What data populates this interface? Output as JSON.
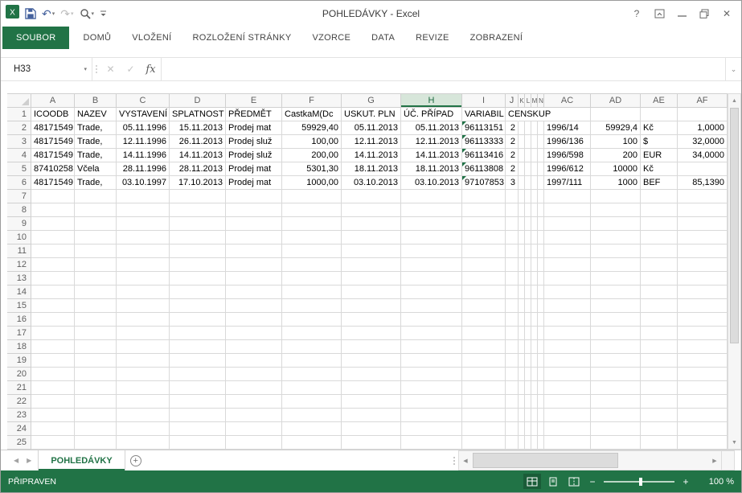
{
  "window": {
    "title": "POHLEDÁVKY - Excel",
    "help_label": "?",
    "close_label": "✕"
  },
  "qat": {
    "icons": [
      "excel-logo",
      "save",
      "undo",
      "redo",
      "print-preview",
      "customize-qat"
    ]
  },
  "ribbon": {
    "tabs": [
      "SOUBOR",
      "DOMŮ",
      "VLOŽENÍ",
      "ROZLOŽENÍ STRÁNKY",
      "VZORCE",
      "DATA",
      "REVIZE",
      "ZOBRAZENÍ"
    ]
  },
  "formula_bar": {
    "name_box": "H33",
    "cancel_label": "✕",
    "enter_label": "✓",
    "fx_label": "fx",
    "formula_value": ""
  },
  "grid": {
    "selected_column": "H",
    "total_rows": 25,
    "columns": [
      {
        "letter": "A",
        "width": 54,
        "align": "right"
      },
      {
        "letter": "B",
        "width": 52,
        "align": "left"
      },
      {
        "letter": "C",
        "width": 66,
        "align": "right"
      },
      {
        "letter": "D",
        "width": 70,
        "align": "right"
      },
      {
        "letter": "E",
        "width": 70,
        "align": "left"
      },
      {
        "letter": "F",
        "width": 74,
        "align": "right"
      },
      {
        "letter": "G",
        "width": 74,
        "align": "right"
      },
      {
        "letter": "H",
        "width": 76,
        "align": "right"
      },
      {
        "letter": "I",
        "width": 54,
        "align": "right"
      },
      {
        "letter": "J",
        "width": 16,
        "align": "right"
      },
      {
        "letter": "K",
        "width": 8,
        "align": "left"
      },
      {
        "letter": "L",
        "width": 8,
        "align": "left"
      },
      {
        "letter": "M",
        "width": 8,
        "align": "left"
      },
      {
        "letter": "N",
        "width": 8,
        "align": "left"
      },
      {
        "letter": "AC",
        "width": 58,
        "align": "left"
      },
      {
        "letter": "AD",
        "width": 62,
        "align": "right"
      },
      {
        "letter": "AE",
        "width": 46,
        "align": "left"
      },
      {
        "letter": "AF",
        "width": 62,
        "align": "right"
      }
    ],
    "header_row": {
      "A": "ICOODB",
      "B": "NAZEV",
      "C": "VYSTAVENÍ",
      "D": "SPLATNOST",
      "E": "PŘEDMĚT",
      "F": "CastkaM(Dc",
      "G": "USKUT. PLN",
      "H": "ÚČ. PŘÍPAD",
      "I": "VARIABIL",
      "J": "CENSKUP"
    },
    "data_rows": [
      {
        "n": 2,
        "A": "48171549",
        "B": "Trade,",
        "C": "05.11.1996",
        "D": "15.11.2013",
        "E": "Prodej mat",
        "F": "59929,40",
        "G": "05.11.2013",
        "H": "05.11.2013",
        "I": "96113151",
        "J": "2",
        "AC": "1996/14",
        "AD": "59929,4",
        "AE": "Kč",
        "AF": "1,0000"
      },
      {
        "n": 3,
        "A": "48171549",
        "B": "Trade,",
        "C": "12.11.1996",
        "D": "26.11.2013",
        "E": "Prodej služ",
        "F": "100,00",
        "G": "12.11.2013",
        "H": "12.11.2013",
        "I": "96113333",
        "J": "2",
        "AC": "1996/136",
        "AD": "100",
        "AE": "$",
        "AF": "32,0000"
      },
      {
        "n": 4,
        "A": "48171549",
        "B": "Trade,",
        "C": "14.11.1996",
        "D": "14.11.2013",
        "E": "Prodej služ",
        "F": "200,00",
        "G": "14.11.2013",
        "H": "14.11.2013",
        "I": "96113416",
        "J": "2",
        "AC": "1996/598",
        "AD": "200",
        "AE": "EUR",
        "AF": "34,0000"
      },
      {
        "n": 5,
        "A": "87410258",
        "B": "Včela",
        "C": "28.11.1996",
        "D": "28.11.2013",
        "E": "Prodej mat",
        "F": "5301,30",
        "G": "18.11.2013",
        "H": "18.11.2013",
        "I": "96113808",
        "J": "2",
        "AC": "1996/612",
        "AD": "10000",
        "AE": "Kč",
        "AF": ""
      },
      {
        "n": 6,
        "A": "48171549",
        "B": "Trade,",
        "C": "03.10.1997",
        "D": "17.10.2013",
        "E": "Prodej mat",
        "F": "1000,00",
        "G": "03.10.2013",
        "H": "03.10.2013",
        "I": "97107853",
        "J": "3",
        "AC": "1997/111",
        "AD": "1000",
        "AE": "BEF",
        "AF": "85,1390"
      }
    ],
    "error_cells": [
      "I2",
      "I3",
      "I4",
      "I5",
      "I6"
    ]
  },
  "sheet_bar": {
    "tab": "POHLEDÁVKY",
    "add_label": "+"
  },
  "status_bar": {
    "mode": "PŘIPRAVEN",
    "zoom": "100 %",
    "zoom_out": "−",
    "zoom_in": "+"
  },
  "colors": {
    "accent": "#217346",
    "error_indicator": "#1f7246"
  }
}
